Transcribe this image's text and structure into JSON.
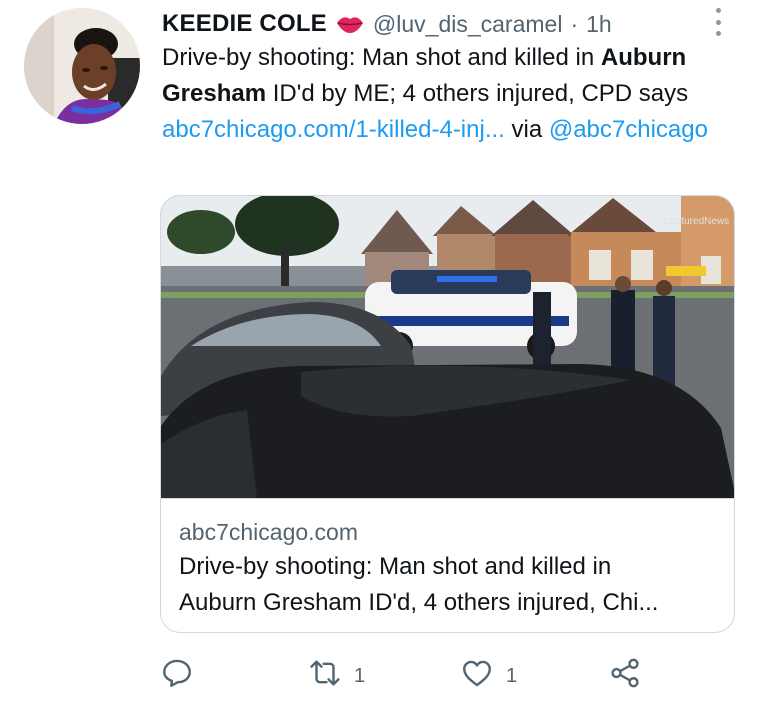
{
  "tweet": {
    "display_name": "KEEDIE COLE",
    "handle": "@luv_dis_caramel",
    "separator": "·",
    "time": "1h",
    "text_part1": "Drive-by shooting: Man shot and killed in ",
    "text_bold": "Auburn Gresham",
    "text_part2": " ID'd by ME; 4 others injured, CPD says ",
    "link_text": "abc7chicago.com/1-killed-4-inj...",
    "text_part3": " via ",
    "mention": "@abc7chicago"
  },
  "card": {
    "watermark": "CapturedNews",
    "domain": "abc7chicago.com",
    "title_line1": "Drive-by shooting: Man shot and killed in",
    "title_line2": "Auburn Gresham ID'd, 4 others injured, Chi..."
  },
  "actions": {
    "reply_count": "",
    "retweet_count": "1",
    "like_count": "1"
  },
  "icons": {
    "reply": "reply-icon",
    "retweet": "retweet-icon",
    "like": "heart-icon",
    "share": "share-icon",
    "more": "more-vertical-icon",
    "emoji": "lips-emoji-icon"
  },
  "colors": {
    "link": "#1d9bf0",
    "secondary_text": "#536471",
    "border": "#cfd9de"
  }
}
